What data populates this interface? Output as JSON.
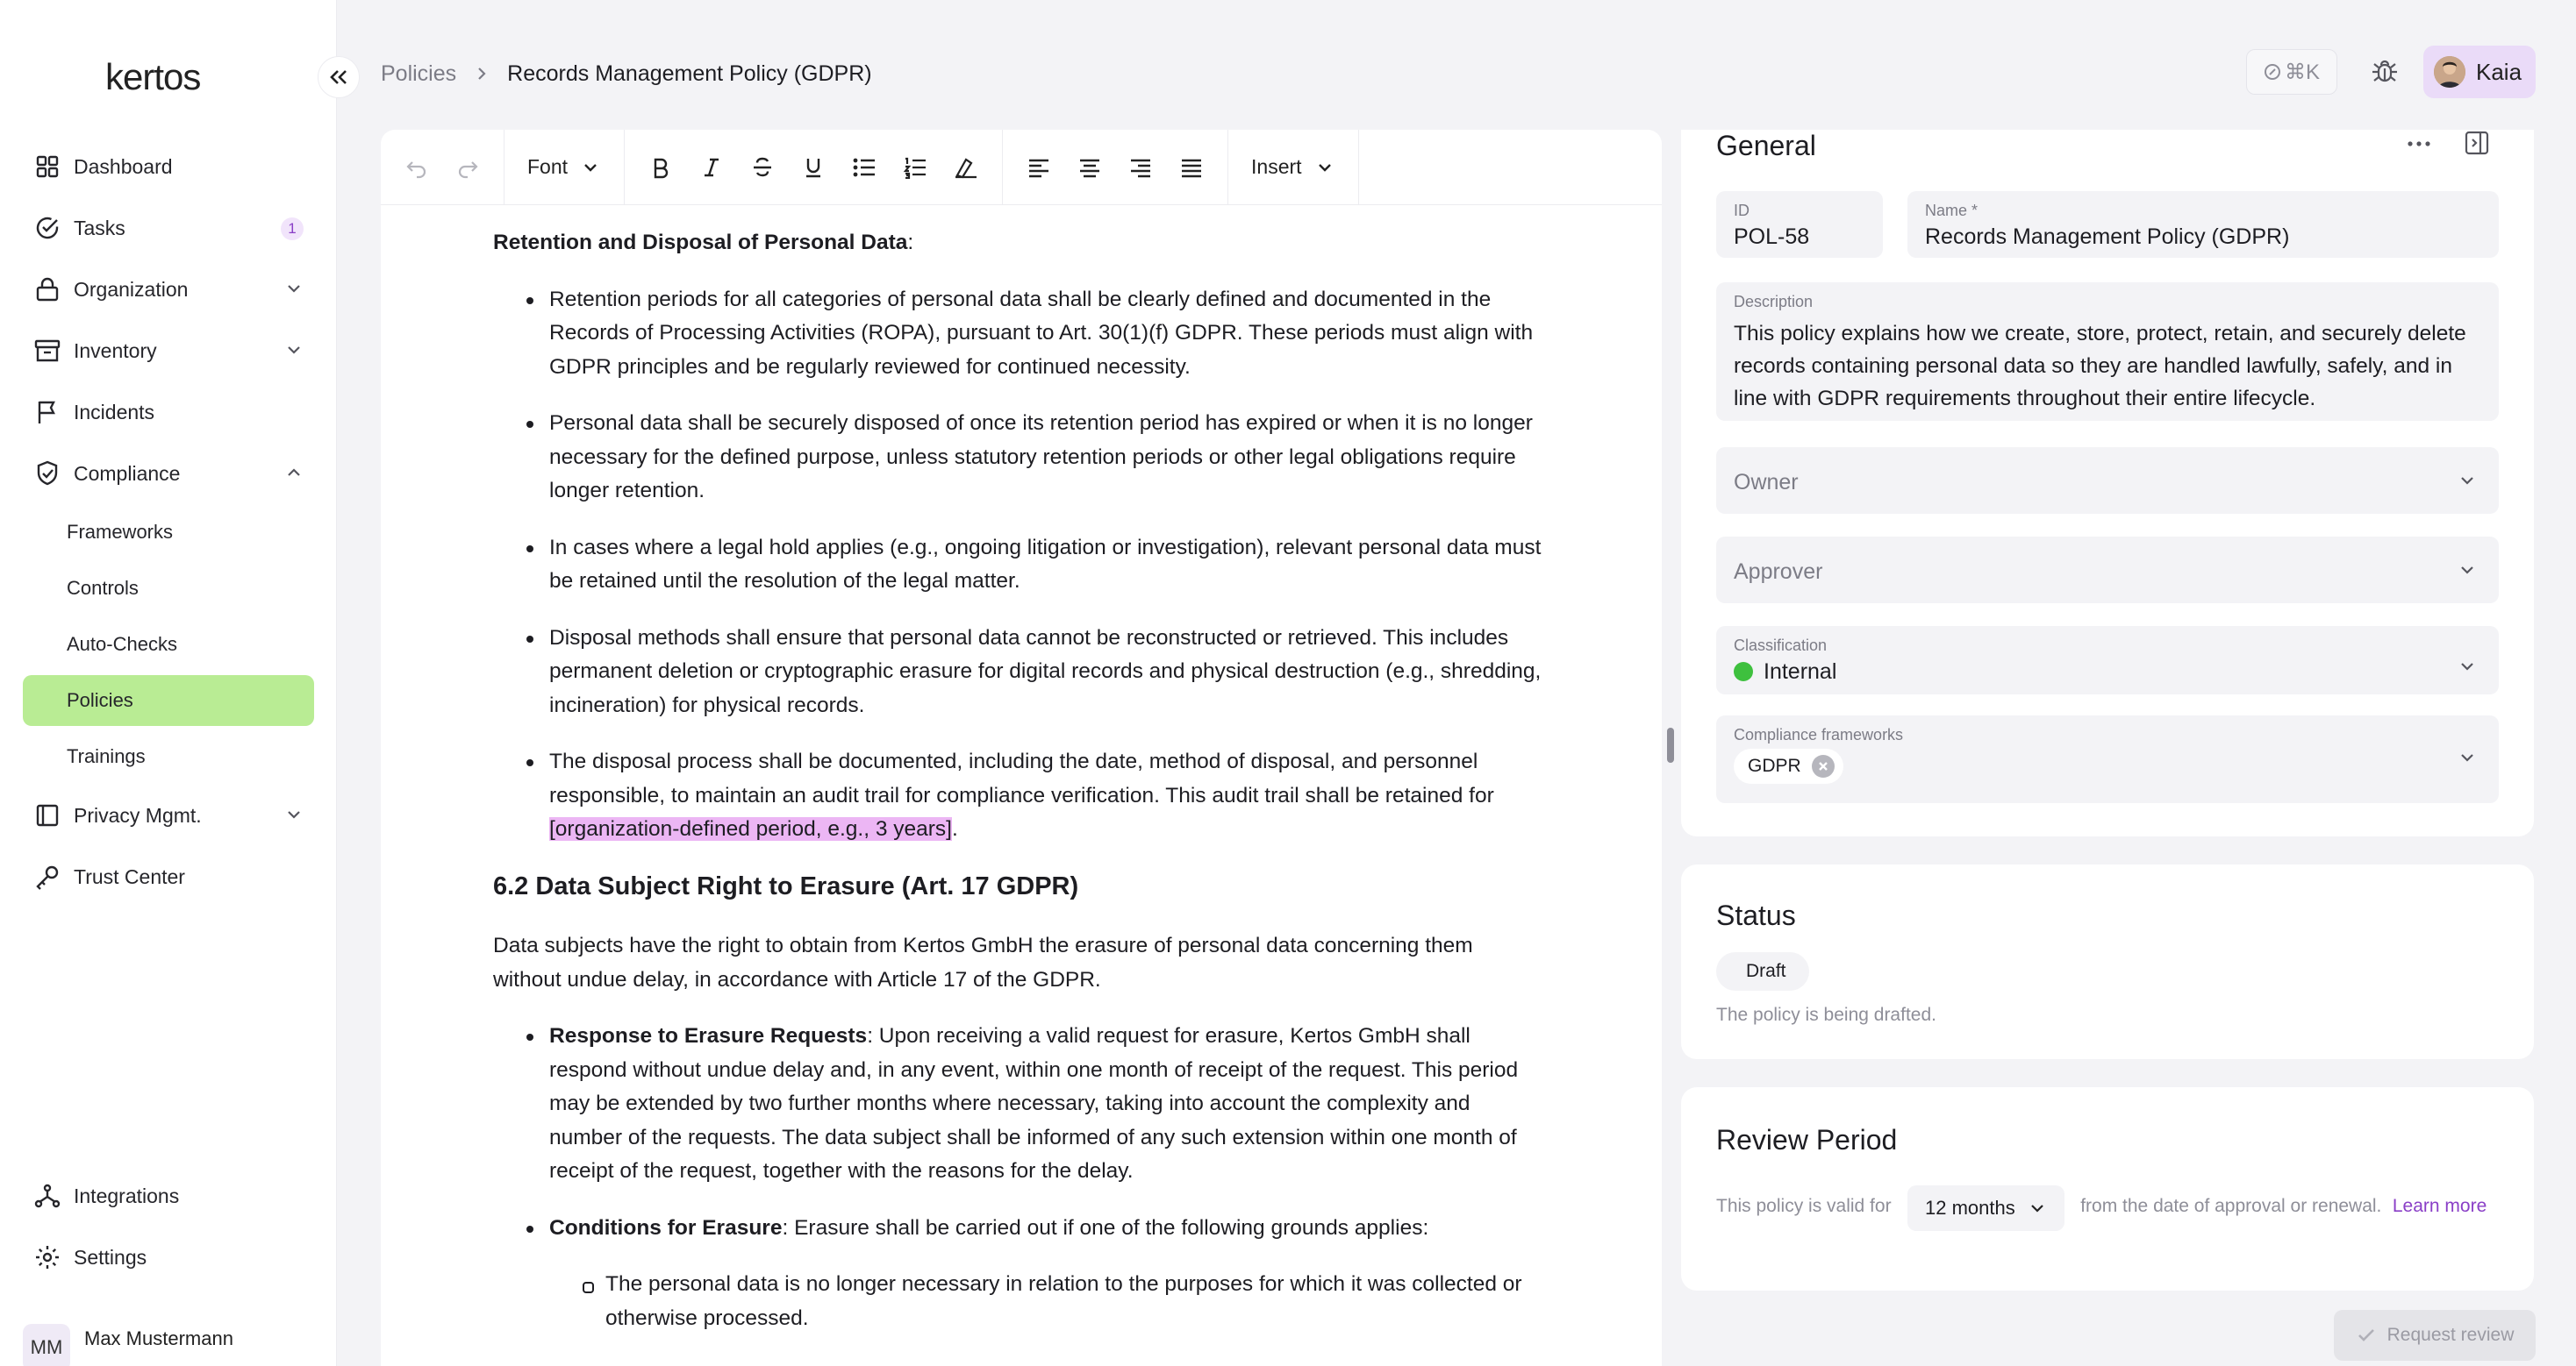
{
  "app": {
    "logo": "kertos"
  },
  "sidebar": {
    "items": [
      {
        "label": "Dashboard",
        "icon": "dashboard-icon"
      },
      {
        "label": "Tasks",
        "icon": "tasks-icon",
        "badge": "1"
      },
      {
        "label": "Organization",
        "icon": "lock-icon"
      },
      {
        "label": "Inventory",
        "icon": "inventory-icon"
      },
      {
        "label": "Incidents",
        "icon": "flag-icon"
      },
      {
        "label": "Compliance",
        "icon": "shield-icon"
      }
    ],
    "compliance_sub": [
      "Frameworks",
      "Controls",
      "Auto-Checks",
      "Policies",
      "Trainings"
    ],
    "after": [
      {
        "label": "Privacy Mgmt.",
        "icon": "privacy-icon"
      },
      {
        "label": "Trust Center",
        "icon": "key-icon"
      }
    ],
    "bottom": [
      {
        "label": "Integrations",
        "icon": "integrations-icon"
      },
      {
        "label": "Settings",
        "icon": "gear-icon"
      }
    ],
    "user": {
      "initials": "MM",
      "name": "Max Mustermann"
    }
  },
  "header": {
    "breadcrumb_parent": "Policies",
    "breadcrumb_current": "Records Management Policy (GDPR)",
    "search_shortcut": "⌘K",
    "user_name": "Kaia"
  },
  "toolbar": {
    "font_label": "Font",
    "insert_label": "Insert"
  },
  "document": {
    "section_title": "Retention and Disposal of Personal Data",
    "section_title_suffix": ":",
    "bullets": [
      "Retention periods for all categories of personal data shall be clearly defined and documented in the Records of Processing Activities (ROPA), pursuant to Art. 30(1)(f) GDPR. These periods must align with GDPR principles and be regularly reviewed for continued necessity.",
      "Personal data shall be securely disposed of once its retention period has expired or when it is no longer necessary for the defined purpose, unless statutory retention periods or other legal obligations require longer retention.",
      "In cases where a legal hold applies (e.g., ongoing litigation or investigation), relevant personal data must be retained until the resolution of the legal matter.",
      "Disposal methods shall ensure that personal data cannot be reconstructed or retrieved. This includes permanent deletion or cryptographic erasure for digital records and physical destruction (e.g., shredding, incineration) for physical records."
    ],
    "bullet5_text": "The disposal process shall be documented, including the date, method of disposal, and personnel responsible, to maintain an audit trail for compliance verification. This audit trail shall be retained for ",
    "bullet5_highlight": "[organization-defined period, e.g., 3 years]",
    "bullet5_end": ".",
    "heading": "6.2 Data Subject Right to Erasure (Art. 17 GDPR)",
    "paragraph": "Data subjects have the right to obtain from Kertos GmbH the erasure of personal data concerning them without undue delay, in accordance with Article 17 of the GDPR.",
    "erasure_title": "Response to Erasure Requests",
    "erasure_text": ": Upon receiving a valid request for erasure, Kertos GmbH shall respond without undue delay and, in any event, within one month of receipt of the request. This period may be extended by two further months where necessary, taking into account the complexity and number of the requests. The data subject shall be informed of any such extension within one month of receipt of the request, together with the reasons for the delay.",
    "conditions_title": "Conditions for Erasure",
    "conditions_text": ": Erasure shall be carried out if one of the following grounds applies:",
    "sub_bullet": "The personal data is no longer necessary in relation to the purposes for which it was collected or otherwise processed."
  },
  "general": {
    "title": "General",
    "id_label": "ID",
    "id_value": "POL-58",
    "name_label": "Name *",
    "name_value": "Records Management Policy (GDPR)",
    "description_label": "Description",
    "description_value": "This policy explains how we create, store, protect, retain, and securely delete records containing personal data so they are handled lawfully, safely, and in line with GDPR requirements throughout their entire lifecycle.",
    "owner_placeholder": "Owner",
    "approver_placeholder": "Approver",
    "classification_label": "Classification",
    "classification_value": "Internal",
    "classification_color": "#3ec03e",
    "frameworks_label": "Compliance frameworks",
    "frameworks": [
      "GDPR"
    ]
  },
  "status": {
    "title": "Status",
    "value": "Draft",
    "description": "The policy is being drafted."
  },
  "review": {
    "title": "Review Period",
    "prefix": "This policy is valid for",
    "period": "12 months",
    "suffix": "from the date of approval or renewal.",
    "learn_more": "Learn more"
  },
  "actions": {
    "request_review": "Request review"
  },
  "colors": {
    "accent": "#8a3fc7",
    "active_nav": "#b9ec94",
    "highlight": "#ecb6f4"
  }
}
